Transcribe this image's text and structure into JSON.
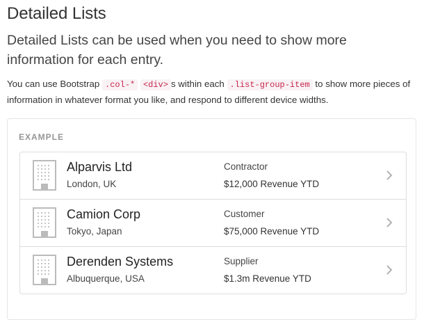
{
  "title": "Detailed Lists",
  "lead": "Detailed Lists can be used when you need to show more information for each entry.",
  "description": {
    "part1": "You can use Bootstrap ",
    "code1": ".col-*",
    "code2": "<div>",
    "part2": "s within each ",
    "code3": ".list-group-item",
    "part3": " to show more pieces of information in whatever format you like, and respond to different device widths."
  },
  "example_label": "EXAMPLE",
  "items": [
    {
      "name": "Alparvis Ltd",
      "location": "London, UK",
      "relationship": "Contractor",
      "revenue": "$12,000 Revenue YTD",
      "icon": "building-icon"
    },
    {
      "name": "Camion Corp",
      "location": "Tokyo, Japan",
      "relationship": "Customer",
      "revenue": "$75,000 Revenue YTD",
      "icon": "building-icon"
    },
    {
      "name": "Derenden Systems",
      "location": "Albuquerque, USA",
      "relationship": "Supplier",
      "revenue": "$1.3m Revenue YTD",
      "icon": "building-icon"
    }
  ],
  "colors": {
    "code_text": "#c7254e",
    "code_bg": "#f9f2f4",
    "border": "#dddddd",
    "icon": "#bbbbbb",
    "chevron": "#b3b3b3"
  }
}
